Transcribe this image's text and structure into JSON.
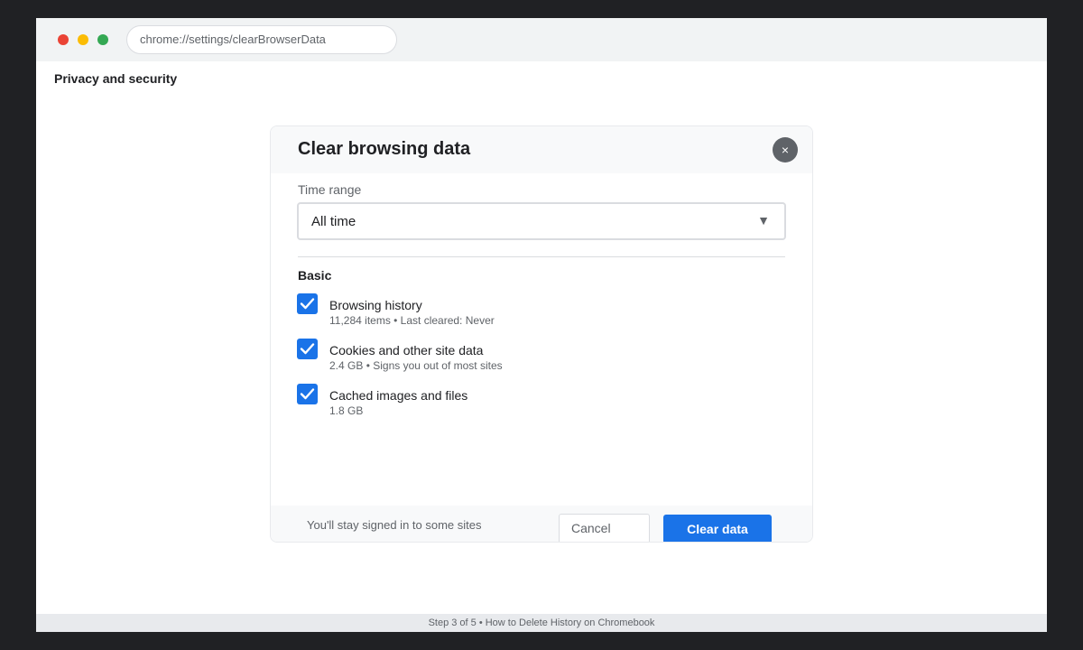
{
  "browser": {
    "url": "chrome://settings/clearBrowserData"
  },
  "page": {
    "heading": "Privacy and security"
  },
  "dialog": {
    "title": "Clear browsing data",
    "close_label": "×",
    "time_range_label": "Time range",
    "time_range_value": "All time",
    "dropdown_arrow": "▼",
    "section_label": "Basic",
    "options": [
      {
        "title": "Browsing history",
        "subtitle": "11,284 items • Last cleared: Never",
        "checked": true
      },
      {
        "title": "Cookies and other site data",
        "subtitle": "2.4 GB • Signs you out of most sites",
        "checked": true
      },
      {
        "title": "Cached images and files",
        "subtitle": "1.8 GB",
        "checked": true
      }
    ],
    "footer_note": "You'll stay signed in to some sites",
    "cancel_label": "Cancel",
    "confirm_label": "Clear data"
  },
  "status_bar": {
    "text": "Step 3 of 5 • How to Delete History on Chromebook"
  },
  "colors": {
    "accent": "#1a73e8",
    "traffic_red": "#ea4335",
    "traffic_yellow": "#fbbc04",
    "traffic_green": "#34a853",
    "close_button": "#5f6368"
  },
  "icons": {
    "close": "close-icon",
    "dropdown": "chevron-down-icon",
    "checkbox": "checkmark-icon"
  }
}
